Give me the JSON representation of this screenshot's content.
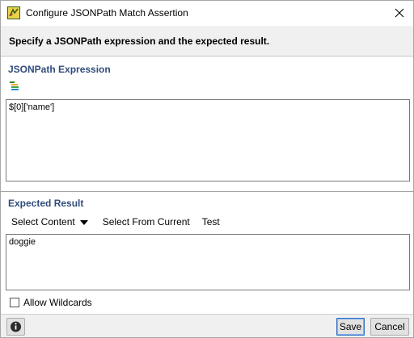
{
  "window": {
    "title": "Configure JSONPath Match Assertion"
  },
  "header": {
    "description": "Specify a JSONPath expression and the expected result."
  },
  "expression": {
    "title": "JSONPath Expression",
    "value": "$[0]['name']"
  },
  "expected": {
    "title": "Expected Result",
    "toolbar": {
      "select_content": "Select Content",
      "select_from_current": "Select From Current",
      "test": "Test"
    },
    "value": "doggie",
    "allow_wildcards_label": "Allow Wildcards",
    "allow_wildcards_checked": false
  },
  "footer": {
    "save_label": "Save",
    "cancel_label": "Cancel"
  },
  "colors": {
    "section_title": "#2f4c7c",
    "window_bg": "#f0f0f0",
    "default_button_border": "#2f6ec7"
  },
  "icons": {
    "app": "soapui-app-icon",
    "close": "close-icon",
    "tool": "jsonpath-tree-icon",
    "info": "info-icon",
    "dropdown": "caret-down-icon"
  }
}
